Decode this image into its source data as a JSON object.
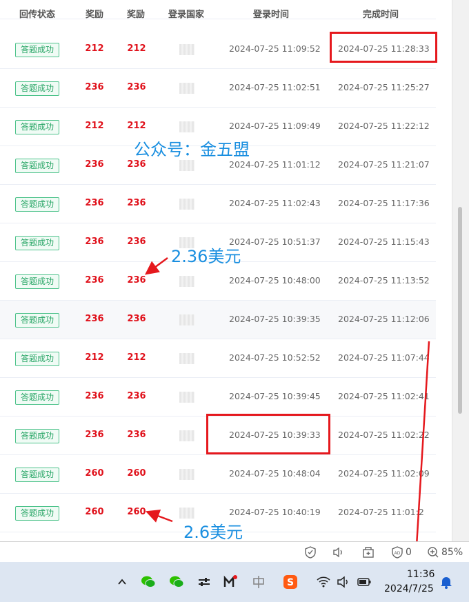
{
  "table": {
    "headers": [
      "回传状态",
      "奖励",
      "奖励",
      "登录国家",
      "登录时间",
      "完成时间"
    ],
    "rows": [
      {
        "status": "答题成功",
        "reward1": "212",
        "reward2": "212",
        "login_time": "2024-07-25 11:09:52",
        "finish_time": "2024-07-25 11:28:33"
      },
      {
        "status": "答题成功",
        "reward1": "236",
        "reward2": "236",
        "login_time": "2024-07-25 11:02:51",
        "finish_time": "2024-07-25 11:25:27"
      },
      {
        "status": "答题成功",
        "reward1": "212",
        "reward2": "212",
        "login_time": "2024-07-25 11:09:49",
        "finish_time": "2024-07-25 11:22:12"
      },
      {
        "status": "答题成功",
        "reward1": "236",
        "reward2": "236",
        "login_time": "2024-07-25 11:01:12",
        "finish_time": "2024-07-25 11:21:07"
      },
      {
        "status": "答题成功",
        "reward1": "236",
        "reward2": "236",
        "login_time": "2024-07-25 11:02:43",
        "finish_time": "2024-07-25 11:17:36"
      },
      {
        "status": "答题成功",
        "reward1": "236",
        "reward2": "236",
        "login_time": "2024-07-25 10:51:37",
        "finish_time": "2024-07-25 11:15:43"
      },
      {
        "status": "答题成功",
        "reward1": "236",
        "reward2": "236",
        "login_time": "2024-07-25 10:48:00",
        "finish_time": "2024-07-25 11:13:52"
      },
      {
        "status": "答题成功",
        "reward1": "236",
        "reward2": "236",
        "login_time": "2024-07-25 10:39:35",
        "finish_time": "2024-07-25 11:12:06"
      },
      {
        "status": "答题成功",
        "reward1": "212",
        "reward2": "212",
        "login_time": "2024-07-25 10:52:52",
        "finish_time": "2024-07-25 11:07:44"
      },
      {
        "status": "答题成功",
        "reward1": "236",
        "reward2": "236",
        "login_time": "2024-07-25 10:39:45",
        "finish_time": "2024-07-25 11:02:41"
      },
      {
        "status": "答题成功",
        "reward1": "236",
        "reward2": "236",
        "login_time": "2024-07-25 10:39:33",
        "finish_time": "2024-07-25 11:02:22"
      },
      {
        "status": "答题成功",
        "reward1": "260",
        "reward2": "260",
        "login_time": "2024-07-25 10:48:04",
        "finish_time": "2024-07-25 11:02:09"
      },
      {
        "status": "答题成功",
        "reward1": "260",
        "reward2": "260",
        "login_time": "2024-07-25 10:40:19",
        "finish_time": "2024-07-25 11:01:2"
      }
    ]
  },
  "annotations": {
    "watermark": "公众号：金五盟",
    "note_236": "2.36美元",
    "note_260": "2.6美元"
  },
  "statusbar": {
    "ad_count": "0",
    "zoom": "85%",
    "icons": [
      "shield-check-icon",
      "read-aloud-icon",
      "add-tab-icon",
      "adblock-icon",
      "zoom-in-icon"
    ]
  },
  "taskbar": {
    "icons": [
      "chevron-up-icon",
      "wechat-icon",
      "wechat-icon",
      "settings-toggle-icon",
      "app-m-icon",
      "ime-zhong-icon",
      "sogou-icon",
      "wifi-icon",
      "volume-icon",
      "battery-icon",
      "notification-bell-icon"
    ],
    "time": "11:36",
    "date": "2024/7/25"
  },
  "colors": {
    "reward_red": "#e0111b",
    "tag_green": "#27a565",
    "annotation_blue": "#1a8fe0",
    "highlight_red": "#e5181d",
    "taskbar_bg": "#dde6f2"
  }
}
